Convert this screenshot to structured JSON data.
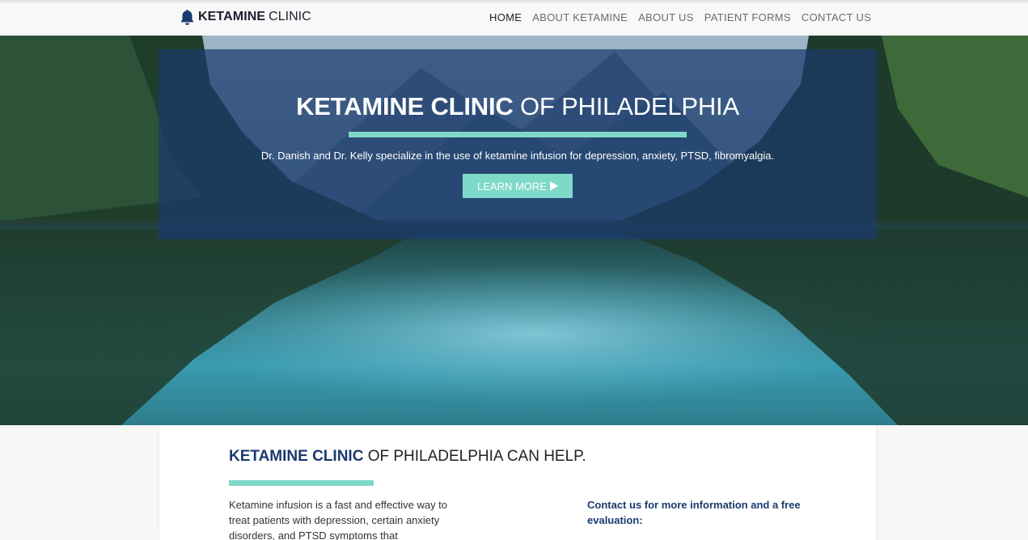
{
  "colors": {
    "accent": "#7fd9c8",
    "brand": "#1b3a6e",
    "nav_bg": "#f8f8f9"
  },
  "header": {
    "brand_bold": "KETAMINE",
    "brand_light": "CLINIC",
    "logo_icon": "bell-icon",
    "nav": [
      {
        "label": "HOME",
        "active": true
      },
      {
        "label": "ABOUT KETAMINE",
        "active": false
      },
      {
        "label": "ABOUT US",
        "active": false
      },
      {
        "label": "PATIENT FORMS",
        "active": false
      },
      {
        "label": "CONTACT US",
        "active": false
      }
    ]
  },
  "hero": {
    "title_bold": "KETAMINE CLINIC",
    "title_light": "OF PHILADELPHIA",
    "subtitle": "Dr. Danish and Dr. Kelly specialize in the use of ketamine infusion for depression, anxiety, PTSD, fibromyalgia.",
    "cta_label": "LEARN MORE",
    "cta_icon": "play-arrow-icon"
  },
  "main": {
    "title_bold": "KETAMINE CLINIC",
    "title_light": "OF PHILADELPHIA CAN HELP.",
    "body": "Ketamine infusion is a fast and effective way to treat patients with depression, certain anxiety disorders, and PTSD symptoms that",
    "contact": "Contact us for more information and a free evaluation:"
  }
}
